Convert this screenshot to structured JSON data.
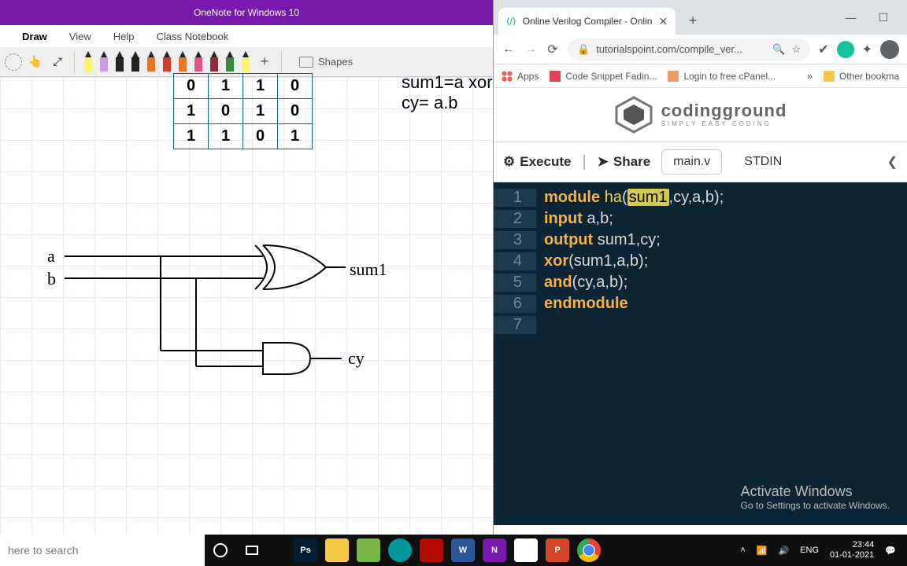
{
  "onenote": {
    "title": "OneNote for Windows 10",
    "tabs": {
      "draw": "Draw",
      "view": "View",
      "help": "Help",
      "classnb": "Class Notebook"
    },
    "shapes_label": "Shapes",
    "eq1": "sum1=a xor",
    "eq2": "cy= a.b",
    "truth_table": [
      [
        "0",
        "1",
        "1",
        "0"
      ],
      [
        "1",
        "0",
        "1",
        "0"
      ],
      [
        "1",
        "1",
        "0",
        "1"
      ]
    ],
    "labels": {
      "a": "a",
      "b": "b",
      "sum1": "sum1",
      "cy": "cy"
    }
  },
  "chrome": {
    "tab_title": "Online Verilog Compiler - Onlin",
    "url": "tutorialspoint.com/compile_ver...",
    "bookmarks": {
      "apps": "Apps",
      "snippet": "Code Snippet Fadin...",
      "cpanel": "Login to free cPanel...",
      "other": "Other bookma"
    },
    "logo_title": "codingground",
    "logo_sub": "SIMPLY  EASY  CODING",
    "toolbar": {
      "execute": "Execute",
      "share": "Share",
      "mainv": "main.v",
      "stdin": "STDIN"
    },
    "divider": "|",
    "code": {
      "l1a": "module",
      "l1b": "ha",
      "l1c": "(",
      "l1d": "sum1",
      "l1e": ",cy,a,b);",
      "l2a": "input",
      "l2b": " a,b;",
      "l3a": "output",
      "l3b": " sum1,cy;",
      "l4a": "xor",
      "l4b": "(sum1,a,b);",
      "l5a": "and",
      "l5b": "(cy,a,b);",
      "l6": "endmodule",
      "n1": "1",
      "n2": "2",
      "n3": "3",
      "n4": "4",
      "n5": "5",
      "n6": "6",
      "n7": "7"
    },
    "watermark": {
      "t1": "Activate Windows",
      "t2": "Go to Settings to activate Windows."
    }
  },
  "taskbar": {
    "search": "here to search",
    "lang": "ENG",
    "time": "23:44",
    "date": "01-01-2021",
    "tray_up": "˄"
  }
}
